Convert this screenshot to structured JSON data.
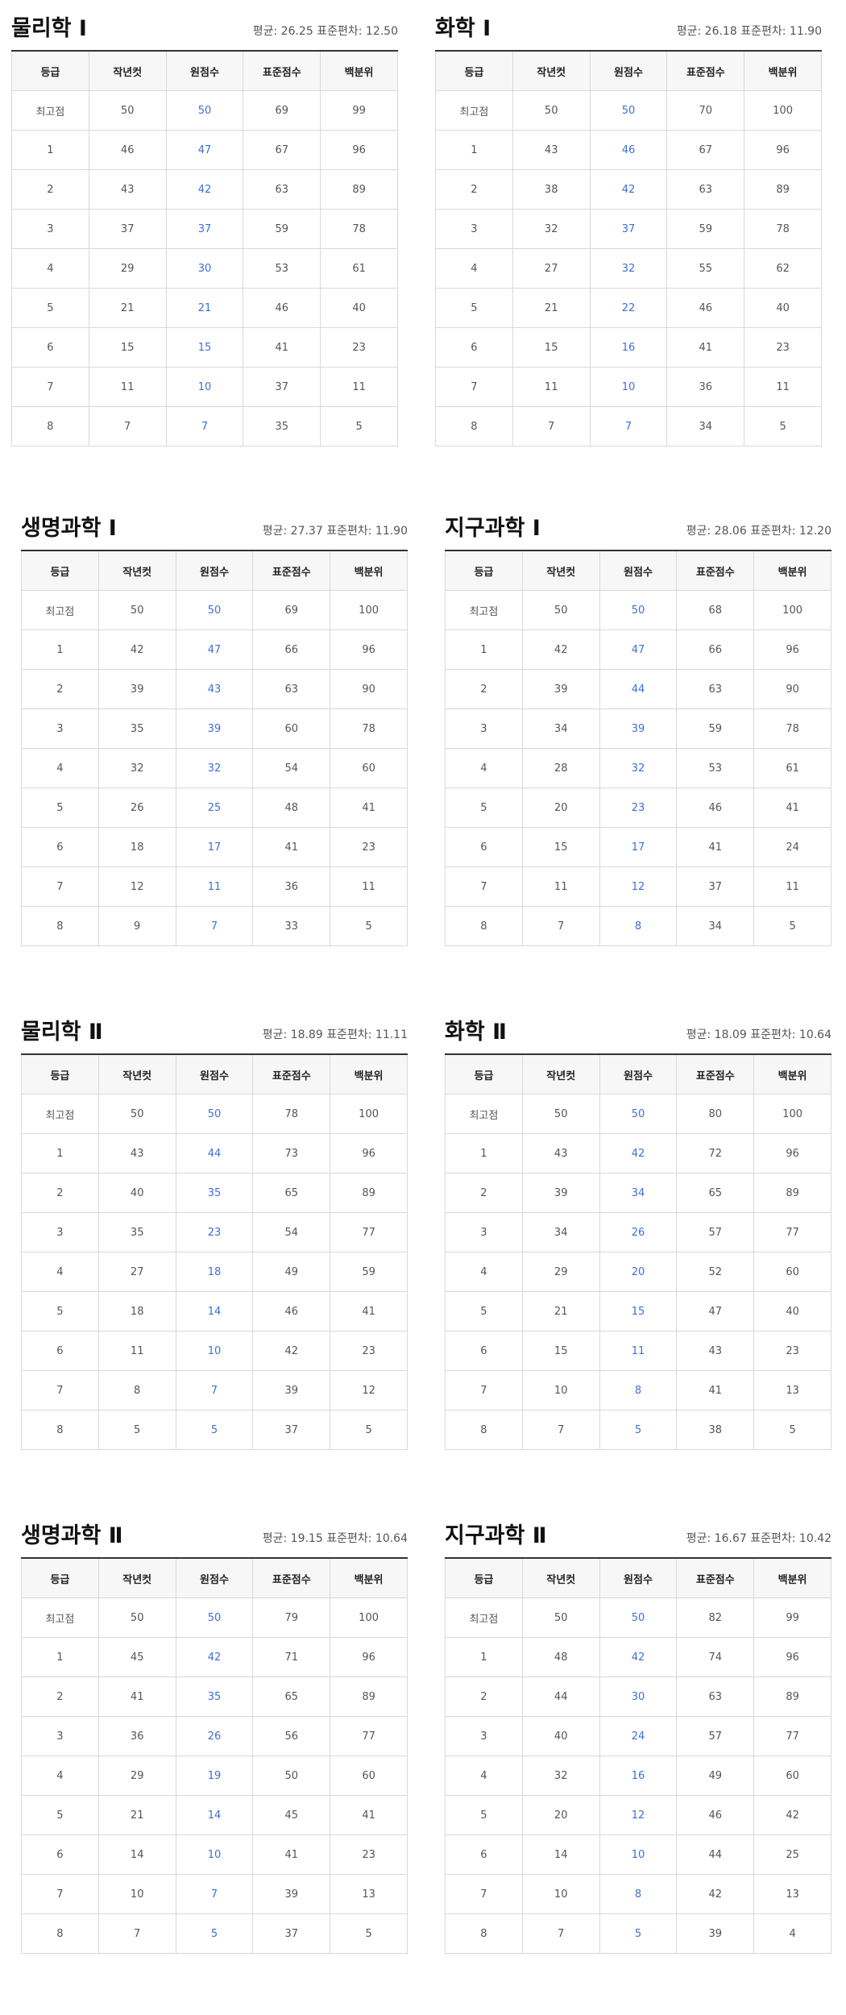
{
  "columns": [
    "등급",
    "작년컷",
    "원점수",
    "표준점수",
    "백분위"
  ],
  "stats_labels": {
    "mean": "평균:",
    "sd": "표준편차:"
  },
  "colors": {
    "raw_score": "#3d6fd8",
    "header_bg": "#f7f7f7",
    "border": "#d9d9d9"
  },
  "subjects": [
    {
      "title": "물리학 Ⅰ",
      "mean": "26.25",
      "sd": "12.50",
      "rows": [
        [
          "최고점",
          "50",
          "50",
          "69",
          "99"
        ],
        [
          "1",
          "46",
          "47",
          "67",
          "96"
        ],
        [
          "2",
          "43",
          "42",
          "63",
          "89"
        ],
        [
          "3",
          "37",
          "37",
          "59",
          "78"
        ],
        [
          "4",
          "29",
          "30",
          "53",
          "61"
        ],
        [
          "5",
          "21",
          "21",
          "46",
          "40"
        ],
        [
          "6",
          "15",
          "15",
          "41",
          "23"
        ],
        [
          "7",
          "11",
          "10",
          "37",
          "11"
        ],
        [
          "8",
          "7",
          "7",
          "35",
          "5"
        ]
      ]
    },
    {
      "title": "화학 Ⅰ",
      "mean": "26.18",
      "sd": "11.90",
      "rows": [
        [
          "최고점",
          "50",
          "50",
          "70",
          "100"
        ],
        [
          "1",
          "43",
          "46",
          "67",
          "96"
        ],
        [
          "2",
          "38",
          "42",
          "63",
          "89"
        ],
        [
          "3",
          "32",
          "37",
          "59",
          "78"
        ],
        [
          "4",
          "27",
          "32",
          "55",
          "62"
        ],
        [
          "5",
          "21",
          "22",
          "46",
          "40"
        ],
        [
          "6",
          "15",
          "16",
          "41",
          "23"
        ],
        [
          "7",
          "11",
          "10",
          "36",
          "11"
        ],
        [
          "8",
          "7",
          "7",
          "34",
          "5"
        ]
      ]
    },
    {
      "title": "생명과학 Ⅰ",
      "mean": "27.37",
      "sd": "11.90",
      "rows": [
        [
          "최고점",
          "50",
          "50",
          "69",
          "100"
        ],
        [
          "1",
          "42",
          "47",
          "66",
          "96"
        ],
        [
          "2",
          "39",
          "43",
          "63",
          "90"
        ],
        [
          "3",
          "35",
          "39",
          "60",
          "78"
        ],
        [
          "4",
          "32",
          "32",
          "54",
          "60"
        ],
        [
          "5",
          "26",
          "25",
          "48",
          "41"
        ],
        [
          "6",
          "18",
          "17",
          "41",
          "23"
        ],
        [
          "7",
          "12",
          "11",
          "36",
          "11"
        ],
        [
          "8",
          "9",
          "7",
          "33",
          "5"
        ]
      ]
    },
    {
      "title": "지구과학 Ⅰ",
      "mean": "28.06",
      "sd": "12.20",
      "rows": [
        [
          "최고점",
          "50",
          "50",
          "68",
          "100"
        ],
        [
          "1",
          "42",
          "47",
          "66",
          "96"
        ],
        [
          "2",
          "39",
          "44",
          "63",
          "90"
        ],
        [
          "3",
          "34",
          "39",
          "59",
          "78"
        ],
        [
          "4",
          "28",
          "32",
          "53",
          "61"
        ],
        [
          "5",
          "20",
          "23",
          "46",
          "41"
        ],
        [
          "6",
          "15",
          "17",
          "41",
          "24"
        ],
        [
          "7",
          "11",
          "12",
          "37",
          "11"
        ],
        [
          "8",
          "7",
          "8",
          "34",
          "5"
        ]
      ]
    },
    {
      "title": "물리학 Ⅱ",
      "mean": "18.89",
      "sd": "11.11",
      "rows": [
        [
          "최고점",
          "50",
          "50",
          "78",
          "100"
        ],
        [
          "1",
          "43",
          "44",
          "73",
          "96"
        ],
        [
          "2",
          "40",
          "35",
          "65",
          "89"
        ],
        [
          "3",
          "35",
          "23",
          "54",
          "77"
        ],
        [
          "4",
          "27",
          "18",
          "49",
          "59"
        ],
        [
          "5",
          "18",
          "14",
          "46",
          "41"
        ],
        [
          "6",
          "11",
          "10",
          "42",
          "23"
        ],
        [
          "7",
          "8",
          "7",
          "39",
          "12"
        ],
        [
          "8",
          "5",
          "5",
          "37",
          "5"
        ]
      ]
    },
    {
      "title": "화학 Ⅱ",
      "mean": "18.09",
      "sd": "10.64",
      "rows": [
        [
          "최고점",
          "50",
          "50",
          "80",
          "100"
        ],
        [
          "1",
          "43",
          "42",
          "72",
          "96"
        ],
        [
          "2",
          "39",
          "34",
          "65",
          "89"
        ],
        [
          "3",
          "34",
          "26",
          "57",
          "77"
        ],
        [
          "4",
          "29",
          "20",
          "52",
          "60"
        ],
        [
          "5",
          "21",
          "15",
          "47",
          "40"
        ],
        [
          "6",
          "15",
          "11",
          "43",
          "23"
        ],
        [
          "7",
          "10",
          "8",
          "41",
          "13"
        ],
        [
          "8",
          "7",
          "5",
          "38",
          "5"
        ]
      ]
    },
    {
      "title": "생명과학 Ⅱ",
      "mean": "19.15",
      "sd": "10.64",
      "rows": [
        [
          "최고점",
          "50",
          "50",
          "79",
          "100"
        ],
        [
          "1",
          "45",
          "42",
          "71",
          "96"
        ],
        [
          "2",
          "41",
          "35",
          "65",
          "89"
        ],
        [
          "3",
          "36",
          "26",
          "56",
          "77"
        ],
        [
          "4",
          "29",
          "19",
          "50",
          "60"
        ],
        [
          "5",
          "21",
          "14",
          "45",
          "41"
        ],
        [
          "6",
          "14",
          "10",
          "41",
          "23"
        ],
        [
          "7",
          "10",
          "7",
          "39",
          "13"
        ],
        [
          "8",
          "7",
          "5",
          "37",
          "5"
        ]
      ]
    },
    {
      "title": "지구과학 Ⅱ",
      "mean": "16.67",
      "sd": "10.42",
      "rows": [
        [
          "최고점",
          "50",
          "50",
          "82",
          "99"
        ],
        [
          "1",
          "48",
          "42",
          "74",
          "96"
        ],
        [
          "2",
          "44",
          "30",
          "63",
          "89"
        ],
        [
          "3",
          "40",
          "24",
          "57",
          "77"
        ],
        [
          "4",
          "32",
          "16",
          "49",
          "60"
        ],
        [
          "5",
          "20",
          "12",
          "46",
          "42"
        ],
        [
          "6",
          "14",
          "10",
          "44",
          "25"
        ],
        [
          "7",
          "10",
          "8",
          "42",
          "13"
        ],
        [
          "8",
          "7",
          "5",
          "39",
          "4"
        ]
      ]
    }
  ]
}
